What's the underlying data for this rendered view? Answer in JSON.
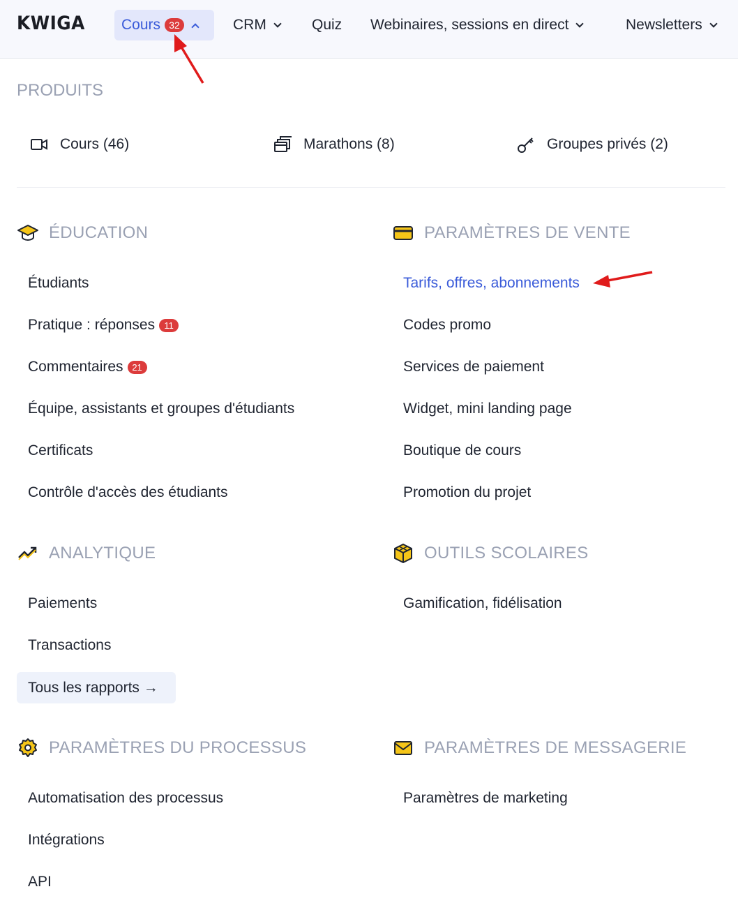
{
  "nav": {
    "logo": "KWIGA",
    "items": [
      {
        "label": "Cours",
        "badge": "32"
      },
      {
        "label": "CRM"
      },
      {
        "label": "Quiz"
      },
      {
        "label": "Webinaires, sessions en direct"
      },
      {
        "label": "Newsletters"
      }
    ]
  },
  "products": {
    "title": "PRODUITS",
    "items": [
      {
        "label": "Cours (46)",
        "icon": "video-camera-icon"
      },
      {
        "label": "Marathons (8)",
        "icon": "stacked-windows-icon"
      },
      {
        "label": "Groupes privés (2)",
        "icon": "key-icon"
      }
    ]
  },
  "education": {
    "title": "ÉDUCATION",
    "icon": "graduation-cap-icon",
    "items": [
      {
        "label": "Étudiants"
      },
      {
        "label": "Pratique : réponses",
        "badge": "11"
      },
      {
        "label": "Commentaires",
        "badge": "21"
      },
      {
        "label": "Équipe, assistants et groupes d'étudiants"
      },
      {
        "label": "Certificats"
      },
      {
        "label": "Contrôle d'accès des étudiants"
      }
    ]
  },
  "sales": {
    "title": "PARAMÈTRES DE VENTE",
    "icon": "credit-card-icon",
    "items": [
      {
        "label": "Tarifs, offres, abonnements"
      },
      {
        "label": "Codes promo"
      },
      {
        "label": "Services de paiement"
      },
      {
        "label": "Widget, mini landing page"
      },
      {
        "label": "Boutique de cours"
      },
      {
        "label": "Promotion du projet"
      }
    ]
  },
  "analytics": {
    "title": "ANALYTIQUE",
    "icon": "trending-up-icon",
    "items": [
      {
        "label": "Paiements"
      },
      {
        "label": "Transactions"
      }
    ],
    "all_reports": "Tous les rapports →"
  },
  "school_tools": {
    "title": "OUTILS SCOLAIRES",
    "icon": "cube-icon",
    "items": [
      {
        "label": "Gamification, fidélisation"
      }
    ]
  },
  "process": {
    "title": "PARAMÈTRES DU PROCESSUS",
    "icon": "gear-icon",
    "items": [
      {
        "label": "Automatisation des processus"
      },
      {
        "label": "Intégrations"
      },
      {
        "label": "API"
      }
    ]
  },
  "messaging": {
    "title": "PARAMÈTRES DE MESSAGERIE",
    "icon": "envelope-icon",
    "items": [
      {
        "label": "Paramètres de marketing"
      }
    ]
  },
  "colors": {
    "accent": "#3a5bd9",
    "badge": "#dc3b3b",
    "icon_yellow": "#f5c518",
    "annotation_arrow": "#e01b1b"
  }
}
